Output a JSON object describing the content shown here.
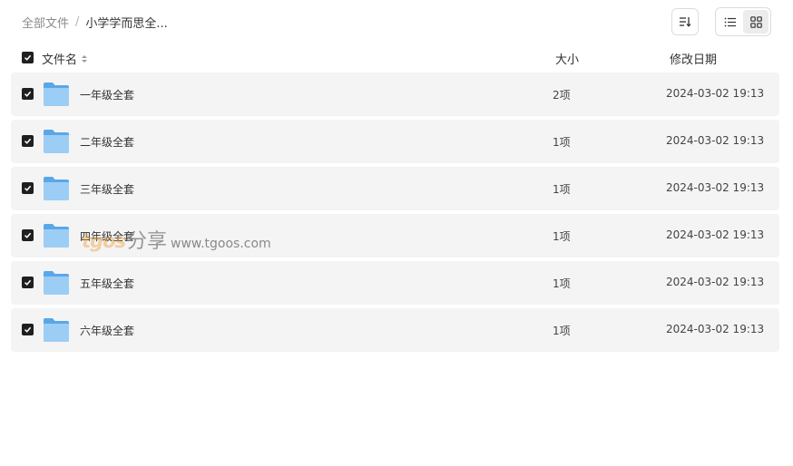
{
  "breadcrumb": {
    "root": "全部文件",
    "separator": "/",
    "current": "小学学而思全..."
  },
  "toolbar": {
    "sort_icon": "sort-icon",
    "list_view_icon": "list-view-icon",
    "grid_view_icon": "grid-view-icon",
    "active_view": "grid"
  },
  "columns": {
    "name": "文件名",
    "size": "大小",
    "date": "修改日期"
  },
  "rows": [
    {
      "name": "一年级全套",
      "size": "2项",
      "date": "2024-03-02 19:13",
      "checked": true
    },
    {
      "name": "二年级全套",
      "size": "1项",
      "date": "2024-03-02 19:13",
      "checked": true
    },
    {
      "name": "三年级全套",
      "size": "1项",
      "date": "2024-03-02 19:13",
      "checked": true
    },
    {
      "name": "四年级全套",
      "size": "1项",
      "date": "2024-03-02 19:13",
      "checked": true
    },
    {
      "name": "五年级全套",
      "size": "1项",
      "date": "2024-03-02 19:13",
      "checked": true
    },
    {
      "name": "六年级全套",
      "size": "1项",
      "date": "2024-03-02 19:13",
      "checked": true
    }
  ],
  "watermark": {
    "logo": "tgos",
    "share": "分享",
    "url": "www.tgoos.com"
  },
  "colors": {
    "row_background": "#f4f4f4",
    "checkbox": "#1f1f1f",
    "folder_blue": "#8cc4f2"
  }
}
